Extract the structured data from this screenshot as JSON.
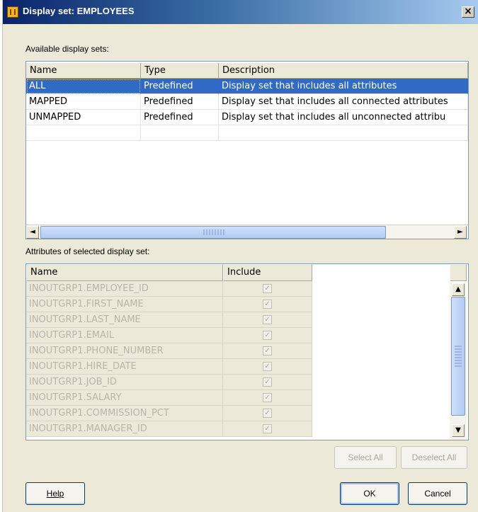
{
  "window": {
    "title": "Display set: EMPLOYEES",
    "close_glyph": "×"
  },
  "available": {
    "label": "Available display sets:",
    "columns": [
      "Name",
      "Type",
      "Description"
    ],
    "rows": [
      {
        "name": "ALL",
        "type": "Predefined",
        "description": "Display set that includes all attributes"
      },
      {
        "name": "MAPPED",
        "type": "Predefined",
        "description": "Display set that includes all connected attributes"
      },
      {
        "name": "UNMAPPED",
        "type": "Predefined",
        "description": "Display set that includes all unconnected attribu"
      }
    ],
    "selected_row": 0
  },
  "attributes": {
    "label": "Attributes of selected display set:",
    "columns": [
      "Name",
      "Include"
    ],
    "rows": [
      {
        "name": "INOUTGRP1.EMPLOYEE_ID",
        "include": true
      },
      {
        "name": "INOUTGRP1.FIRST_NAME",
        "include": true
      },
      {
        "name": "INOUTGRP1.LAST_NAME",
        "include": true
      },
      {
        "name": "INOUTGRP1.EMAIL",
        "include": true
      },
      {
        "name": "INOUTGRP1.PHONE_NUMBER",
        "include": true
      },
      {
        "name": "INOUTGRP1.HIRE_DATE",
        "include": true
      },
      {
        "name": "INOUTGRP1.JOB_ID",
        "include": true
      },
      {
        "name": "INOUTGRP1.SALARY",
        "include": true
      },
      {
        "name": "INOUTGRP1.COMMISSION_PCT",
        "include": true
      },
      {
        "name": "INOUTGRP1.MANAGER_ID",
        "include": true
      }
    ]
  },
  "buttons": {
    "select_all": "Select All",
    "deselect_all": "Deselect All",
    "help": "Help",
    "ok": "OK",
    "cancel": "Cancel"
  },
  "icons": {
    "window_icon": "display-set-icon",
    "scroll_left": "◄",
    "scroll_right": "►",
    "scroll_up": "▲",
    "scroll_down": "▼",
    "check": "✓"
  },
  "colors": {
    "selection": "#316ac5",
    "titlebar_start": "#0a246a",
    "dialog_bg": "#ece9d8"
  }
}
